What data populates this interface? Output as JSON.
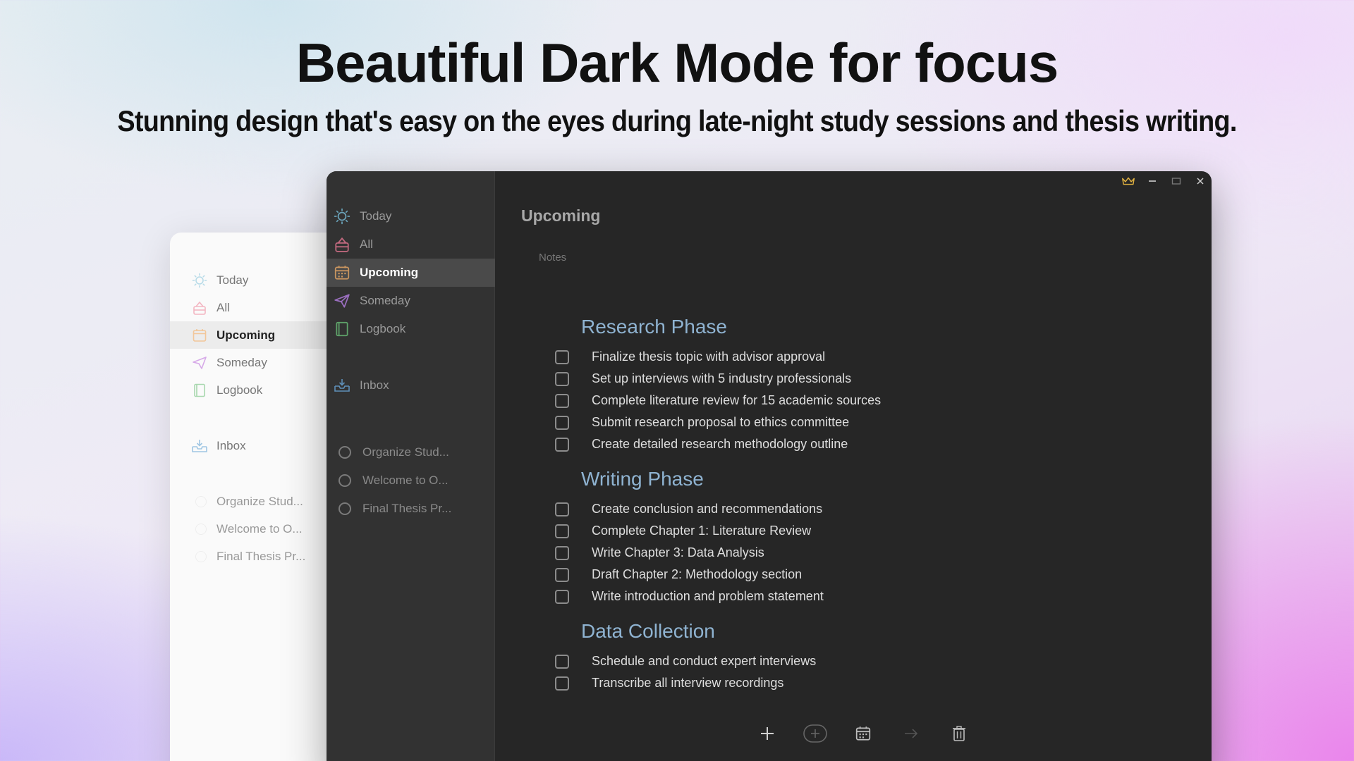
{
  "marketing": {
    "headline": "Beautiful Dark Mode for focus",
    "subheadline": "Stunning design that's easy on the eyes during late-night study sessions and thesis writing."
  },
  "light_window": {
    "nav": [
      {
        "label": "Today",
        "icon": "sun-icon"
      },
      {
        "label": "All",
        "icon": "all-icon"
      },
      {
        "label": "Upcoming",
        "icon": "calendar-icon"
      },
      {
        "label": "Someday",
        "icon": "paper-plane-icon"
      },
      {
        "label": "Logbook",
        "icon": "logbook-icon"
      }
    ],
    "inbox": "Inbox",
    "projects": [
      "Organize Stud...",
      "Welcome to O...",
      "Final Thesis Pr..."
    ]
  },
  "sidebar": {
    "nav": [
      {
        "label": "Today",
        "icon": "sun-icon"
      },
      {
        "label": "All",
        "icon": "all-icon"
      },
      {
        "label": "Upcoming",
        "icon": "calendar-icon"
      },
      {
        "label": "Someday",
        "icon": "paper-plane-icon"
      },
      {
        "label": "Logbook",
        "icon": "logbook-icon"
      }
    ],
    "inbox": "Inbox",
    "projects": [
      "Organize Stud...",
      "Welcome to O...",
      "Final Thesis Pr..."
    ]
  },
  "main": {
    "title": "Upcoming",
    "notes_placeholder": "Notes",
    "sections": [
      {
        "heading": "Research Phase",
        "tasks": [
          "Finalize thesis topic with advisor approval",
          "Set up interviews with 5 industry professionals",
          "Complete literature review for 15 academic sources",
          "Submit research proposal to ethics committee",
          "Create detailed research methodology outline"
        ]
      },
      {
        "heading": "Writing Phase",
        "tasks": [
          "Create conclusion and recommendations",
          "Complete Chapter 1: Literature Review",
          "Write Chapter 3: Data Analysis",
          "Draft Chapter 2: Methodology section",
          "Write introduction and problem statement"
        ]
      },
      {
        "heading": "Data Collection",
        "tasks": [
          "Schedule and conduct expert interviews",
          "Transcribe all interview recordings"
        ]
      }
    ]
  },
  "toolbar": [
    "add-icon",
    "add-circle-icon",
    "calendar-icon",
    "arrow-right-icon",
    "trash-icon"
  ],
  "colors": {
    "accent_heading": "#8fb3d1",
    "sidebar_bg": "#323232",
    "main_bg": "#262626",
    "crown": "#e3b341"
  }
}
